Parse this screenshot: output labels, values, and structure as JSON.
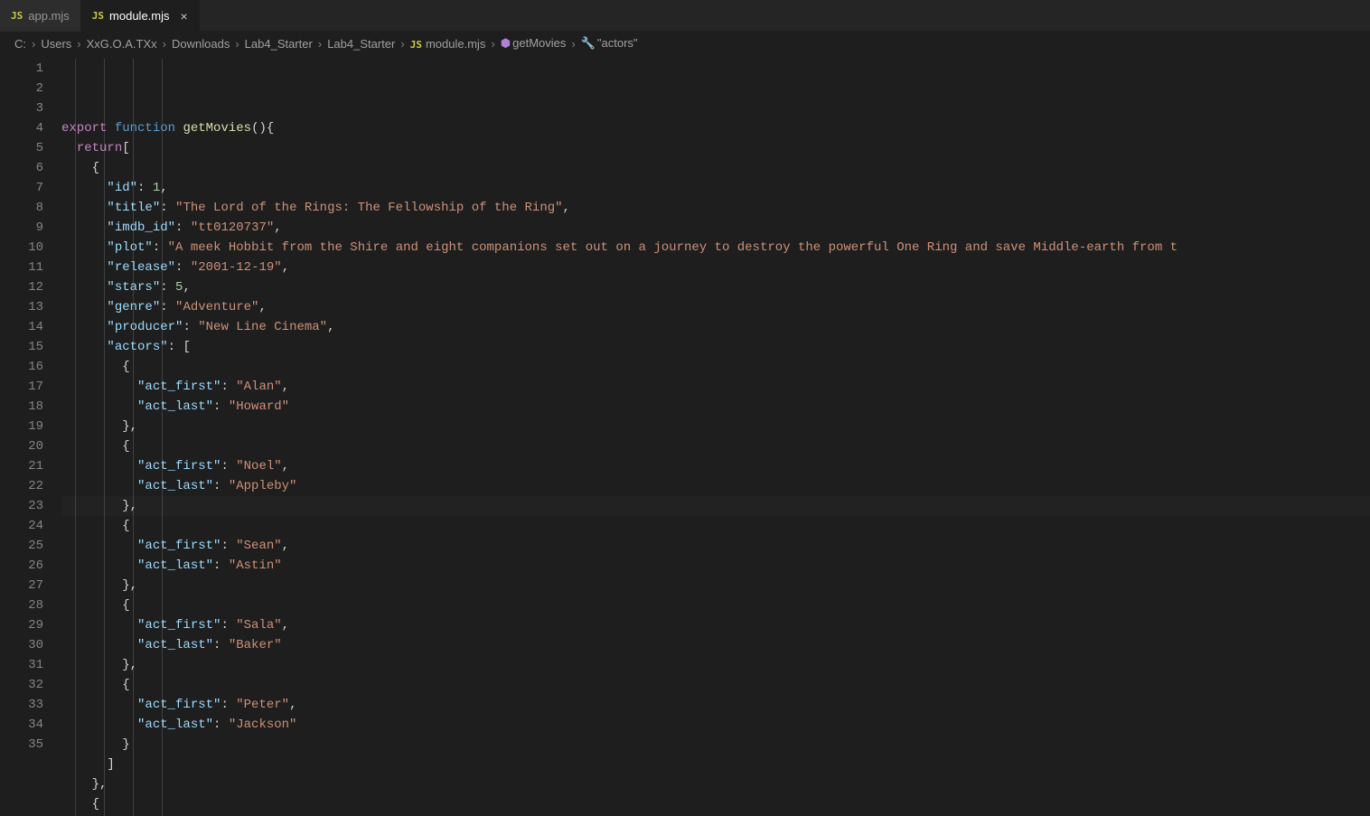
{
  "tabs": [
    {
      "icon": "JS",
      "label": "app.mjs",
      "active": false,
      "close": false
    },
    {
      "icon": "JS",
      "label": "module.mjs",
      "active": true,
      "close": true
    }
  ],
  "breadcrumbs": {
    "parts": [
      "C:",
      "Users",
      "XxG.O.A.TXx",
      "Downloads",
      "Lab4_Starter",
      "Lab4_Starter"
    ],
    "file_icon": "JS",
    "file": "module.mjs",
    "symbol_icon": "cube",
    "symbol": "getMovies",
    "prop_icon": "wrench",
    "prop": "\"actors\""
  },
  "line_start": 1,
  "line_end": 35,
  "active_line": 20,
  "code": {
    "fn_name": "getMovies",
    "movie": {
      "id": 1,
      "title": "The Lord of the Rings: The Fellowship of the Ring",
      "imdb_id": "tt0120737",
      "plot": "A meek Hobbit from the Shire and eight companions set out on a journey to destroy the powerful One Ring and save Middle-earth from t",
      "release": "2001-12-19",
      "stars": 5,
      "genre": "Adventure",
      "producer": "New Line Cinema",
      "actors": [
        {
          "act_first": "Alan",
          "act_last": "Howard"
        },
        {
          "act_first": "Noel",
          "act_last": "Appleby"
        },
        {
          "act_first": "Sean",
          "act_last": "Astin"
        },
        {
          "act_first": "Sala",
          "act_last": "Baker"
        },
        {
          "act_first": "Peter",
          "act_last": "Jackson"
        }
      ]
    }
  }
}
